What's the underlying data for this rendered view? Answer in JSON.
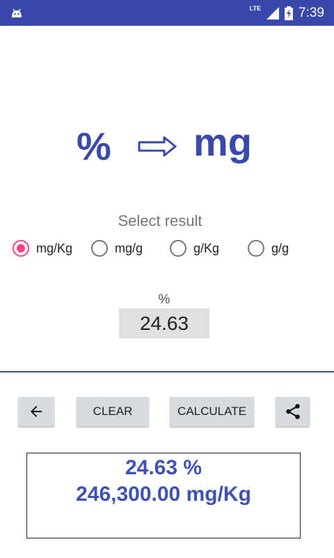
{
  "status_bar": {
    "notification_icon": "android-icon",
    "network_label": "LTE",
    "time": "7:39",
    "color": "#3949ab"
  },
  "title": {
    "from_unit": "%",
    "arrow_icon": "right-double-arrow-icon",
    "to_unit": "mg",
    "color": "#3949ab"
  },
  "select_result": {
    "label": "Select result",
    "options": [
      {
        "label": "mg/Kg",
        "checked": true
      },
      {
        "label": "mg/g",
        "checked": false
      },
      {
        "label": "g/Kg",
        "checked": false
      },
      {
        "label": "g/g",
        "checked": false
      }
    ],
    "accent_color": "#ff4081"
  },
  "input": {
    "unit_label": "%",
    "value": "24.63"
  },
  "buttons": {
    "back_icon": "arrow-left-icon",
    "clear_label": "CLEAR",
    "calculate_label": "CALCULATE",
    "share_icon": "share-icon"
  },
  "result": {
    "line1": "24.63 %",
    "line2": "246,300.00 mg/Kg",
    "color": "#3f51b5"
  }
}
